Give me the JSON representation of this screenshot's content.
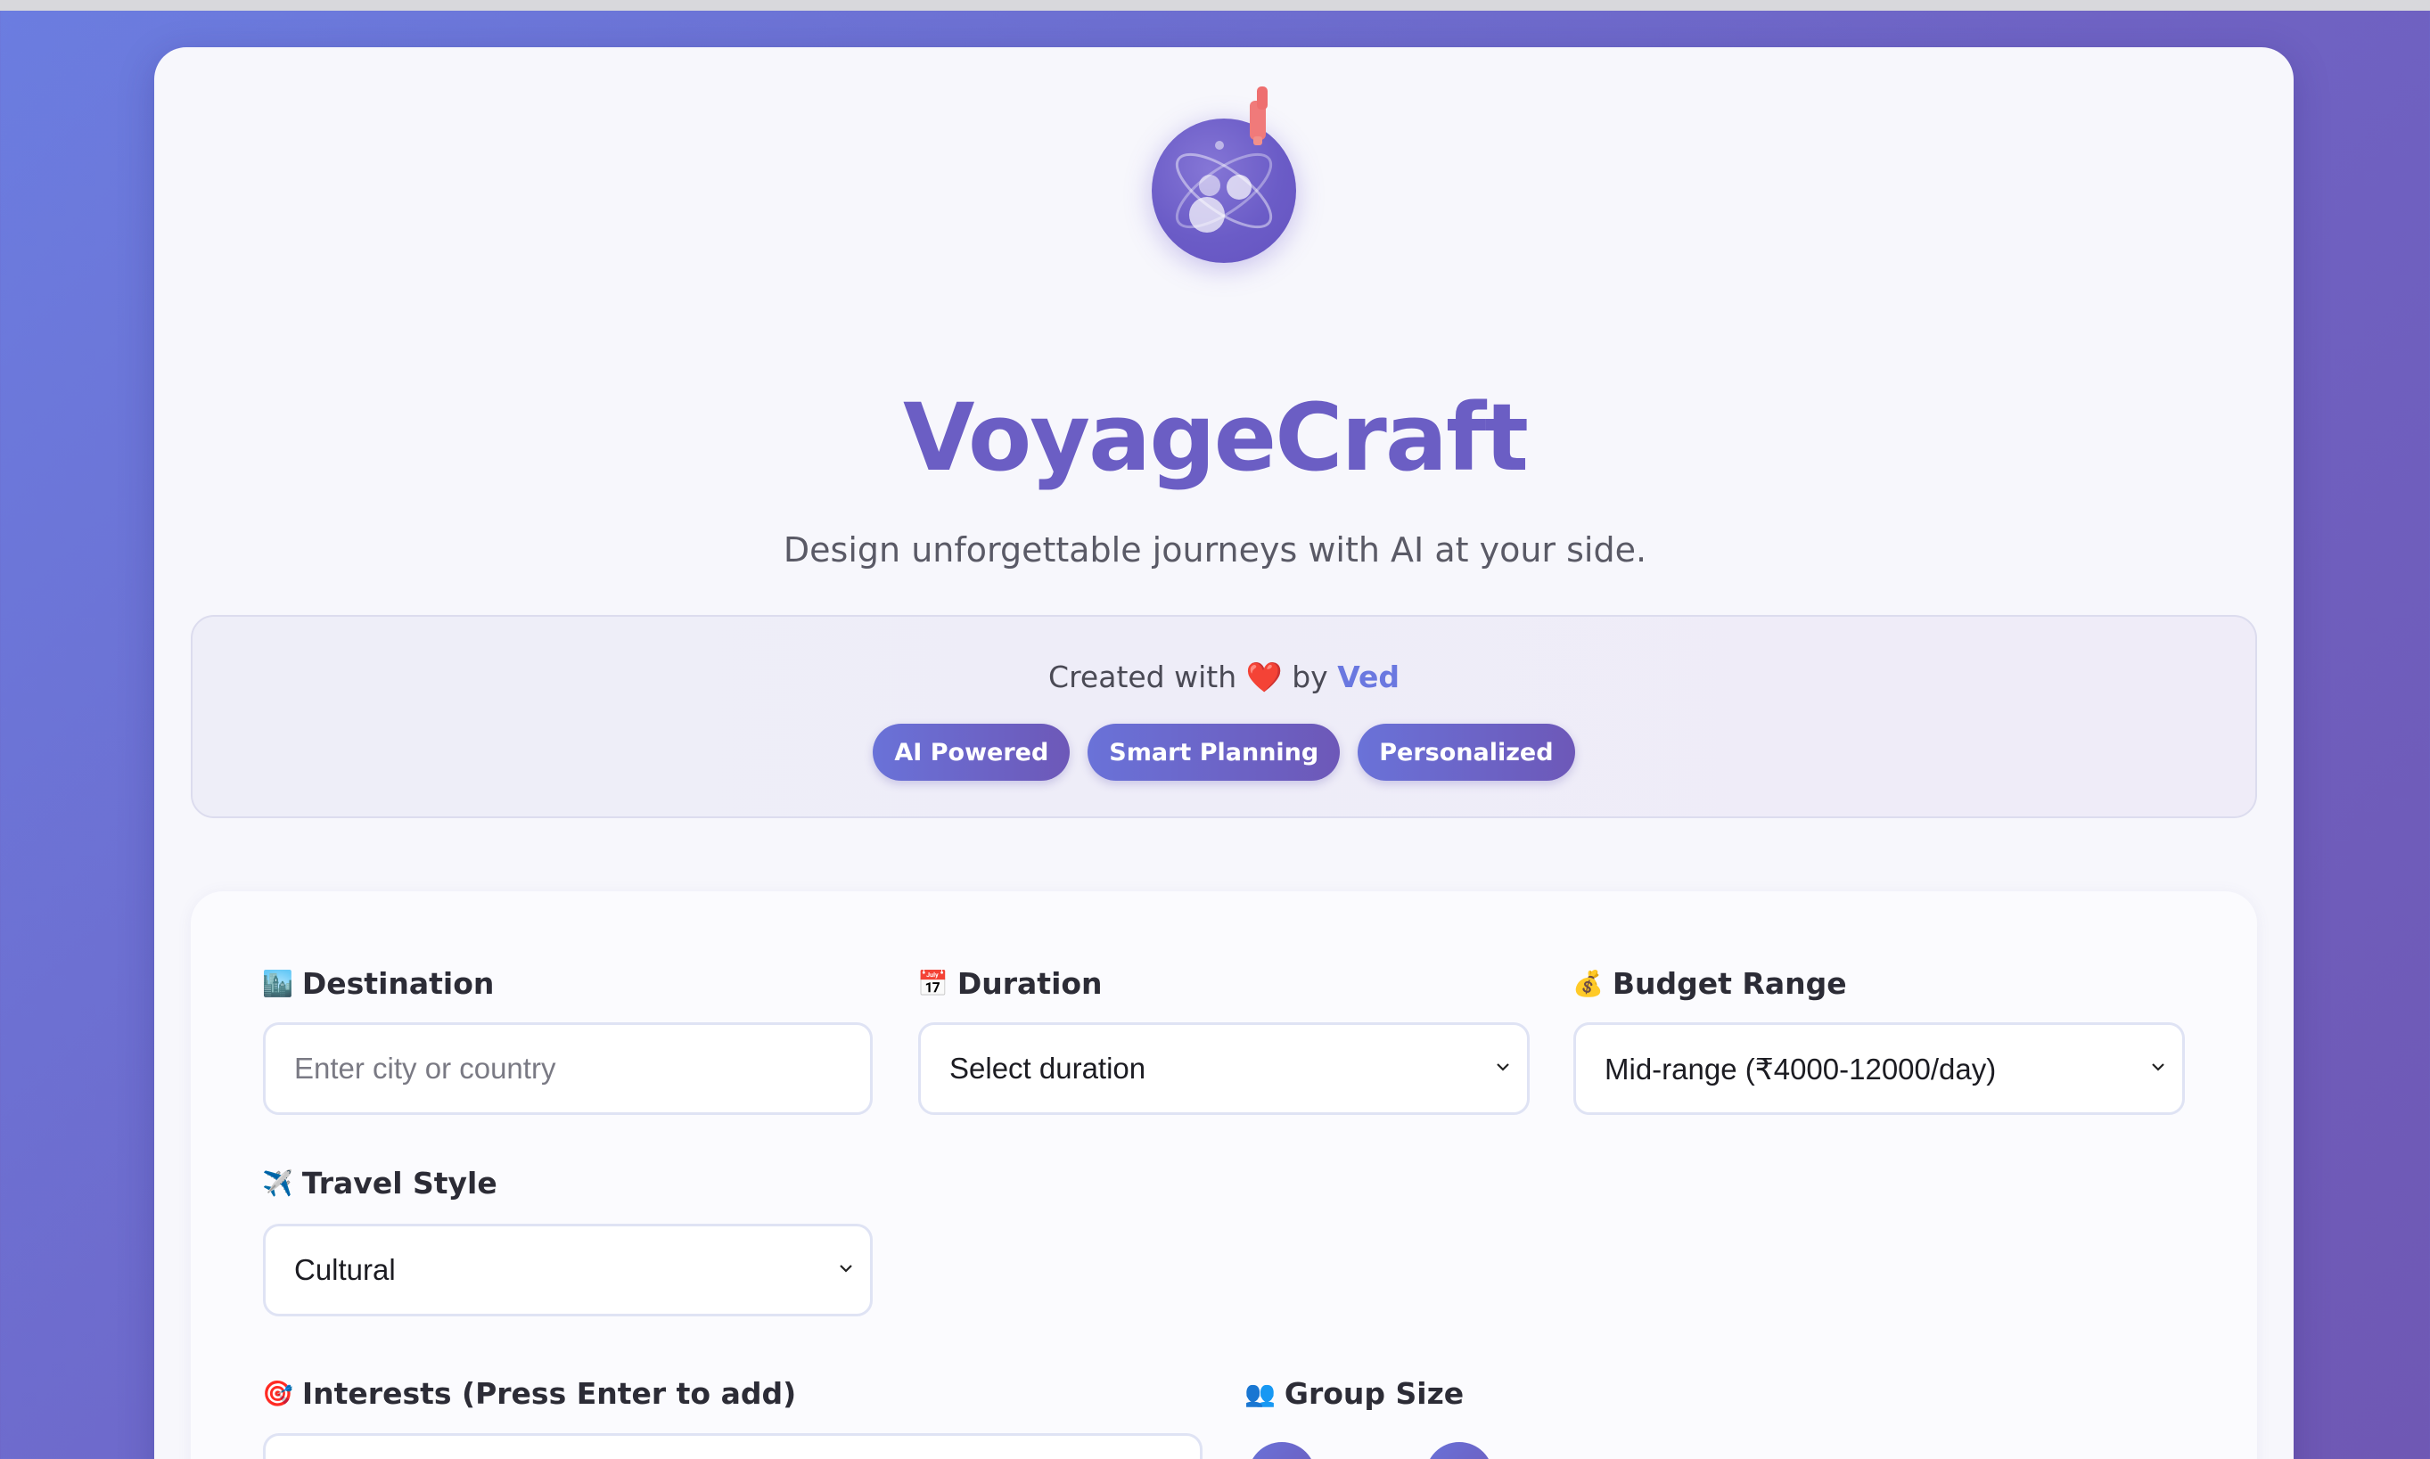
{
  "app": {
    "title": "VoyageCraft",
    "subtitle": "Design unforgettable journeys with AI at your side."
  },
  "credit": {
    "prefix": "Created with",
    "heart": "❤️",
    "by": "by",
    "author": "Ved"
  },
  "badges": [
    "AI Powered",
    "Smart Planning",
    "Personalized"
  ],
  "form": {
    "destination": {
      "emoji": "🏙️",
      "label": "Destination",
      "placeholder": "Enter city or country"
    },
    "duration": {
      "emoji": "📅",
      "label": "Duration",
      "value": "Select duration"
    },
    "budget": {
      "emoji": "💰",
      "label": "Budget Range",
      "value": "Mid-range (₹4000-12000/day)"
    },
    "travel_style": {
      "emoji": "✈️",
      "label": "Travel Style",
      "value": "Cultural"
    },
    "interests": {
      "emoji": "🎯",
      "label": "Interests (Press Enter to add)"
    },
    "group_size": {
      "emoji": "👥",
      "label": "Group Size"
    }
  },
  "icons": {
    "logo": "atom-globe-icon",
    "rocket": "rocket-icon",
    "chevron": "chevron-down-icon"
  },
  "colors": {
    "accent": "#6b5ec4",
    "author": "#6a78e0",
    "heart": "#e0282d"
  }
}
